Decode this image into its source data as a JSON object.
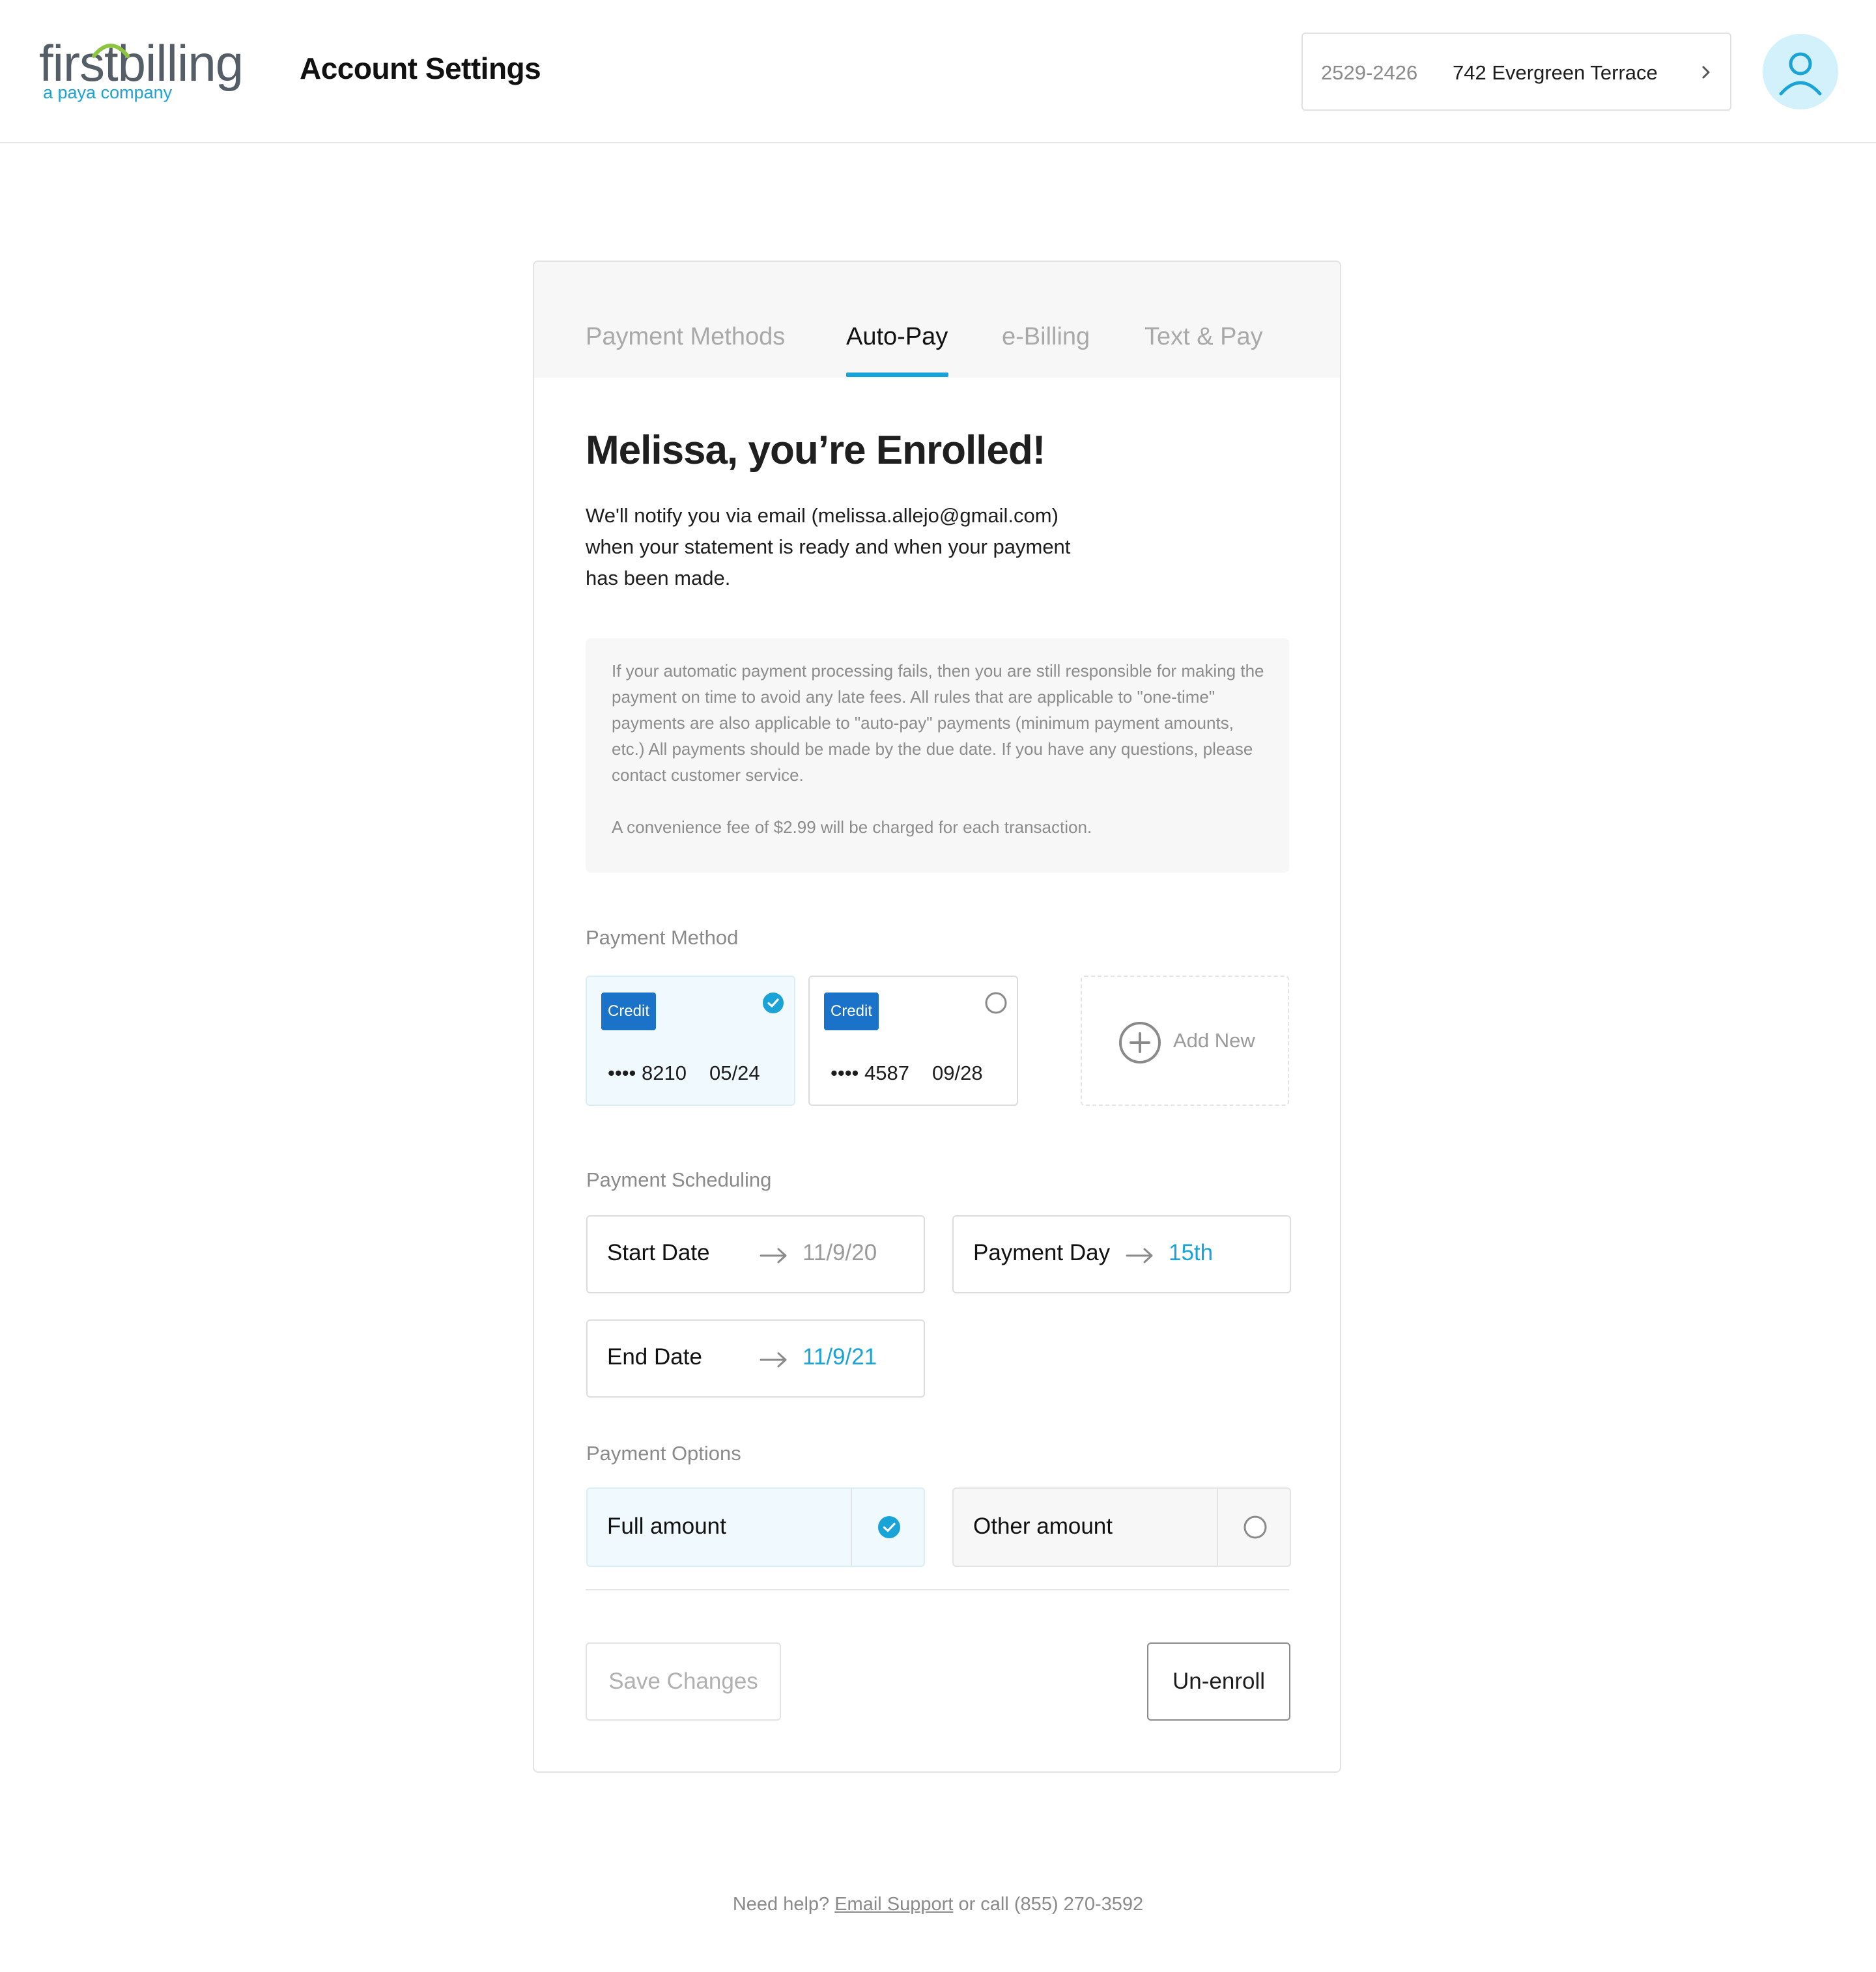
{
  "header": {
    "logo_main": "firstbilling",
    "logo_sub": "a paya company",
    "title": "Account Settings",
    "account_number": "2529-2426",
    "account_address": "742 Evergreen Terrace",
    "avatar_icon": "user-icon",
    "chevron_icon": "chevron-right-icon"
  },
  "tabs": [
    {
      "label": "Payment Methods",
      "active": false
    },
    {
      "label": "Auto-Pay",
      "active": true
    },
    {
      "label": "e-Billing",
      "active": false
    },
    {
      "label": "Text & Pay",
      "active": false
    }
  ],
  "enrolled": {
    "title": "Melissa, you’re Enrolled!",
    "message": "We'll notify you via email (melissa.allejo@gmail.com) when your statement is ready and when your payment has been made."
  },
  "notice": {
    "paragraph1": "If your automatic payment processing fails, then you are still responsible for making the payment on time to avoid any late fees. All rules that are applicable to \"one-time\" payments are also applicable to \"auto-pay\" payments (minimum payment amounts, etc.) All payments should be made by the due date. If you have any questions, please contact customer service.",
    "paragraph2": "A convenience fee of $2.99 will be charged for each transaction."
  },
  "payment_method": {
    "label": "Payment Method",
    "cards": [
      {
        "type": "Credit",
        "number": "•••• 8210",
        "expiry": "05/24",
        "selected": true
      },
      {
        "type": "Credit",
        "number": "•••• 4587",
        "expiry": "09/28",
        "selected": false
      }
    ],
    "add_new_label": "Add New",
    "add_new_icon": "plus-circle-icon"
  },
  "scheduling": {
    "label": "Payment Scheduling",
    "start_date_label": "Start Date",
    "start_date_value": "11/9/20",
    "payment_day_label": "Payment Day",
    "payment_day_value": "15th",
    "end_date_label": "End Date",
    "end_date_value": "11/9/21",
    "arrow_icon": "arrow-right-icon"
  },
  "options": {
    "label": "Payment Options",
    "full_amount_label": "Full amount",
    "full_amount_selected": true,
    "other_amount_label": "Other amount",
    "other_amount_selected": false
  },
  "actions": {
    "save_label": "Save Changes",
    "unenroll_label": "Un-enroll"
  },
  "footer": {
    "help_text": "Need help?",
    "email_link": "Email Support",
    "call_text": "or call (855) 270-3592"
  },
  "colors": {
    "accent": "#1aa3d6",
    "badge": "#1a73c9",
    "selected_bg": "#f0f9fd",
    "muted_text": "#8a8a8a"
  }
}
